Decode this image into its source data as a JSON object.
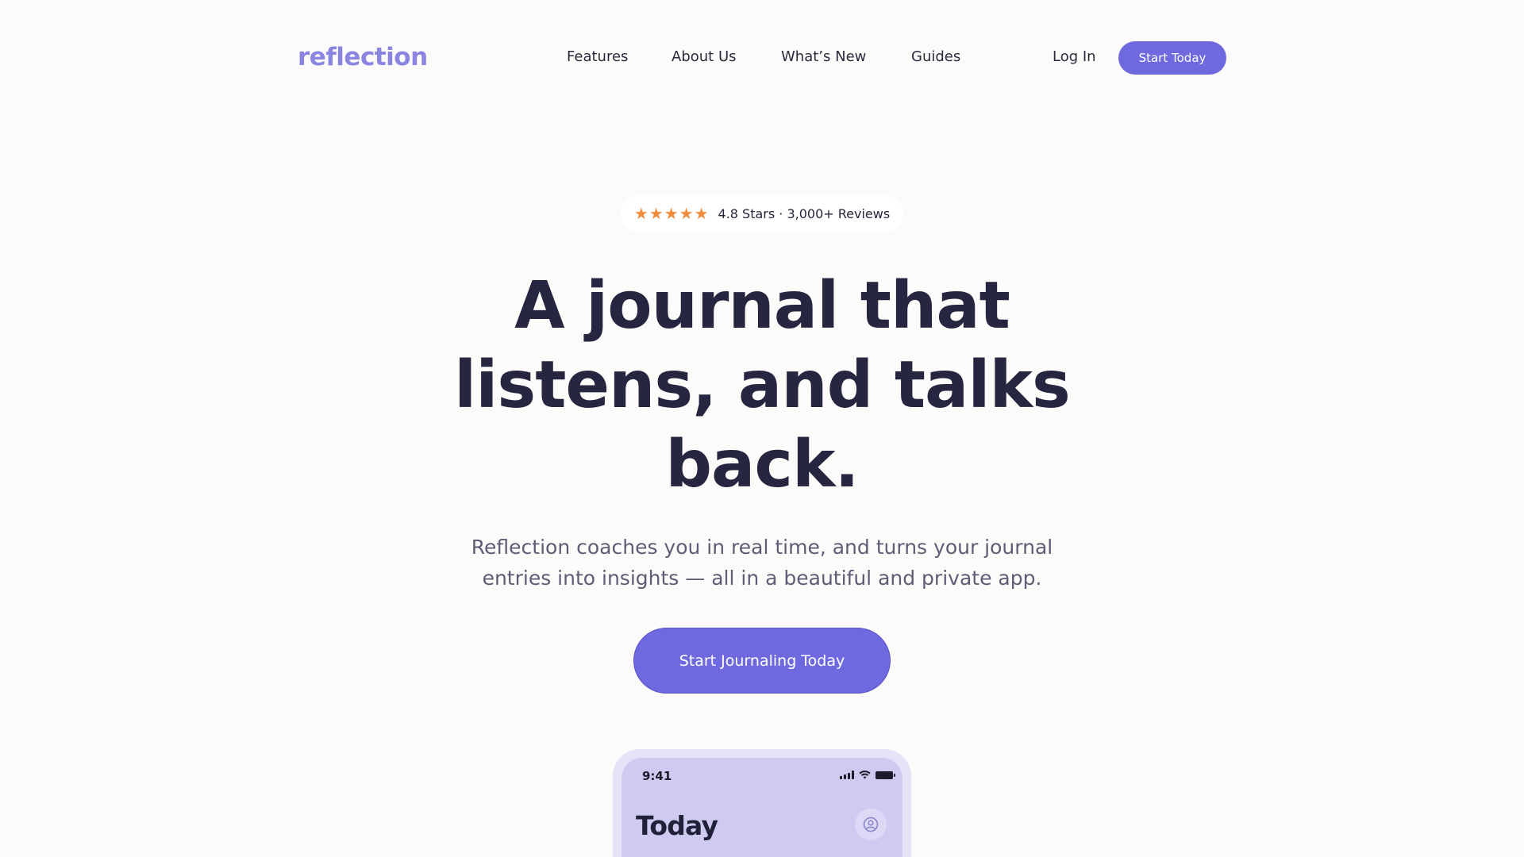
{
  "brand": {
    "logo_text": "reflection",
    "accent_color": "#6f69e0",
    "logo_color": "#8a85e0"
  },
  "nav": {
    "links": [
      "Features",
      "About Us",
      "What’s New",
      "Guides"
    ],
    "login_label": "Log In",
    "cta_label": "Start Today"
  },
  "rating": {
    "stars_icon": "star-icon",
    "star_count": 5,
    "star_color": "#f08c3c",
    "text": "4.8 Stars · 3,000+ Reviews"
  },
  "hero": {
    "headline_lines": [
      "A journal that",
      "listens, and talks",
      "back."
    ],
    "subhead_lines": [
      "Reflection coaches you in real time, and turns your journal",
      "entries into insights — all in a beautiful and private app."
    ],
    "cta_label": "Start Journaling Today"
  },
  "phone": {
    "status_time": "9:41",
    "screen_title": "Today",
    "profile_icon": "user-circle-icon"
  }
}
